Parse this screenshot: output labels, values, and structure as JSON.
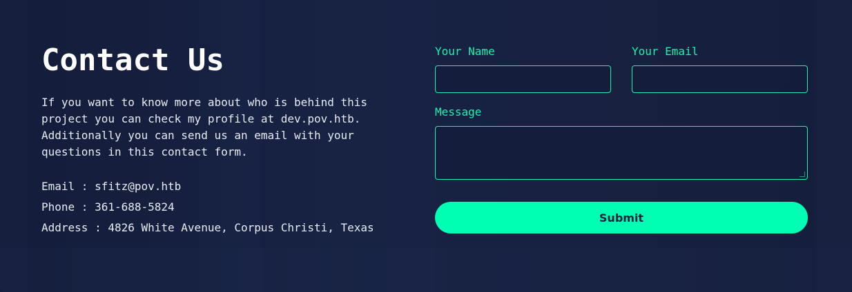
{
  "contact": {
    "title": "Contact Us",
    "intro": "If you want to know more about who is behind this project you can check my profile at dev.pov.htb. Additionally you can send us an email with your questions in this contact form.",
    "email_line": "Email : sfitz@pov.htb",
    "phone_line": "Phone : 361-688-5824",
    "address_line": "Address : 4826 White Avenue, Corpus Christi, Texas"
  },
  "form": {
    "name_label": "Your Name",
    "name_value": "",
    "email_label": "Your Email",
    "email_value": "",
    "message_label": "Message",
    "message_value": "",
    "submit_label": "Submit"
  },
  "colors": {
    "background": "#16203d",
    "accent": "#18f4ad",
    "button": "#00ffb2",
    "button_text": "#16203d"
  }
}
